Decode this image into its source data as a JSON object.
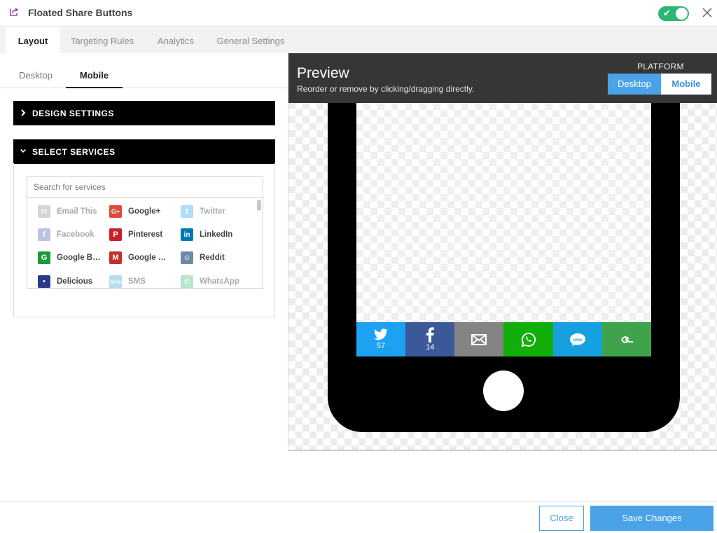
{
  "header": {
    "title": "Floated Share Buttons"
  },
  "top_tabs": [
    {
      "label": "Layout"
    },
    {
      "label": "Targeting Rules"
    },
    {
      "label": "Analytics"
    },
    {
      "label": "General Settings"
    }
  ],
  "sub_tabs": [
    {
      "label": "Desktop"
    },
    {
      "label": "Mobile"
    }
  ],
  "design_settings": {
    "label": "DESIGN SETTINGS"
  },
  "select_services": {
    "label": "SELECT SERVICES",
    "search_placeholder": "Search for services",
    "services": [
      {
        "label": "Email This",
        "enabled": false,
        "color": "#888888",
        "icon": "email-icon"
      },
      {
        "label": "Google+",
        "enabled": true,
        "color": "#dd4b39",
        "icon": "google-plus-icon"
      },
      {
        "label": "Twitter",
        "enabled": false,
        "color": "#1da1f2",
        "icon": "twitter-icon"
      },
      {
        "label": "Facebook",
        "enabled": false,
        "color": "#3b5998",
        "icon": "facebook-icon"
      },
      {
        "label": "Pinterest",
        "enabled": true,
        "color": "#cb2027",
        "icon": "pinterest-icon"
      },
      {
        "label": "LinkedIn",
        "enabled": true,
        "color": "#0077b5",
        "icon": "linkedin-icon"
      },
      {
        "label": "Google B…",
        "enabled": true,
        "color": "#1a9a3a",
        "icon": "google-bookmarks-icon"
      },
      {
        "label": "Google …",
        "enabled": true,
        "color": "#c4302b",
        "icon": "gmail-icon"
      },
      {
        "label": "Reddit",
        "enabled": true,
        "color": "#6b8aa8",
        "icon": "reddit-icon"
      },
      {
        "label": "Delicious",
        "enabled": true,
        "color": "#2a3a8a",
        "icon": "delicious-icon"
      },
      {
        "label": "SMS",
        "enabled": false,
        "color": "#2a9fd6",
        "icon": "sms-icon"
      },
      {
        "label": "WhatsApp",
        "enabled": false,
        "color": "#2bb673",
        "icon": "whatsapp-icon"
      }
    ]
  },
  "preview": {
    "title": "Preview",
    "subtitle": "Reorder or remove by clicking/dragging directly.",
    "platform_label": "PLATFORM",
    "platform_desktop": "Desktop",
    "platform_mobile": "Mobile"
  },
  "share_buttons": [
    {
      "name": "twitter",
      "color": "#1da1f2",
      "count": "57",
      "icon": "twitter-icon"
    },
    {
      "name": "facebook",
      "color": "#3b5998",
      "count": "14",
      "icon": "facebook-icon"
    },
    {
      "name": "email",
      "color": "#848484",
      "count": "",
      "icon": "email-icon"
    },
    {
      "name": "whatsapp",
      "color": "#12af0a",
      "count": "",
      "icon": "whatsapp-icon"
    },
    {
      "name": "sms",
      "color": "#17a0e0",
      "count": "",
      "icon": "sms-icon"
    },
    {
      "name": "more",
      "color": "#3ea34b",
      "count": "",
      "icon": "more-share-icon"
    }
  ],
  "footer": {
    "close_label": "Close",
    "save_label": "Save Changes"
  },
  "colors": {
    "accent": "#4aa3e8",
    "toggle_on": "#2bb673",
    "preview_header": "#363636"
  }
}
